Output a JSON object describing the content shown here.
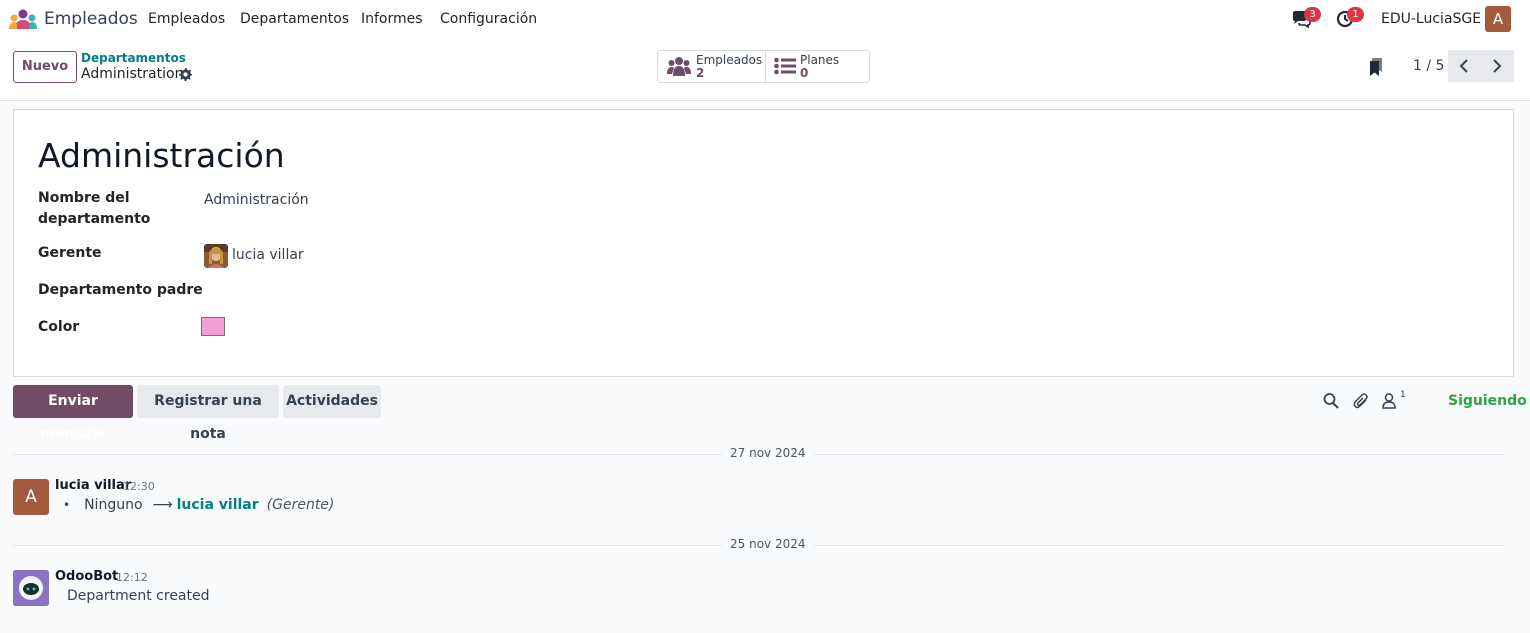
{
  "navbar": {
    "app_name": "Empleados",
    "menu": [
      "Empleados",
      "Departamentos",
      "Informes",
      "Configuración"
    ],
    "messages_badge": "3",
    "activities_badge": "1",
    "company": "EDU-LuciaSGE",
    "user_initial": "A"
  },
  "control": {
    "new_label": "Nuevo",
    "breadcrumb_parent": "Departamentos",
    "breadcrumb_current": "Administration",
    "smart_buttons": [
      {
        "label": "Empleados",
        "value": "2",
        "icon": "users-icon"
      },
      {
        "label": "Planes",
        "value": "0",
        "icon": "list-icon"
      }
    ],
    "pager": "1 / 5"
  },
  "form": {
    "title": "Administración",
    "fields": {
      "name_label_line1": "Nombre del",
      "name_label_line2": "departamento",
      "name_value": "Administración",
      "manager_label": "Gerente",
      "manager_value": "lucia villar",
      "parent_label": "Departamento padre",
      "parent_value": "",
      "color_label": "Color",
      "color_value": "#f49fd4"
    }
  },
  "chatter": {
    "send_message": "Enviar mensaje",
    "log_note": "Registrar una nota",
    "activities": "Actividades",
    "followers_count": "1",
    "following": "Siguiendo",
    "messages": [
      {
        "date": "27 nov 2024",
        "author": "lucia villar",
        "time": "12:30",
        "avatar_initial": "A",
        "old_value": "Ninguno",
        "new_value": "lucia villar",
        "field": "(Gerente)"
      },
      {
        "date": "25 nov 2024",
        "author": "OdooBot",
        "time": "12:12",
        "body": "Department created"
      }
    ]
  },
  "colors": {
    "brand": "#714b67",
    "link": "#017e84",
    "following": "#28a745",
    "badge": "#dc3545"
  }
}
